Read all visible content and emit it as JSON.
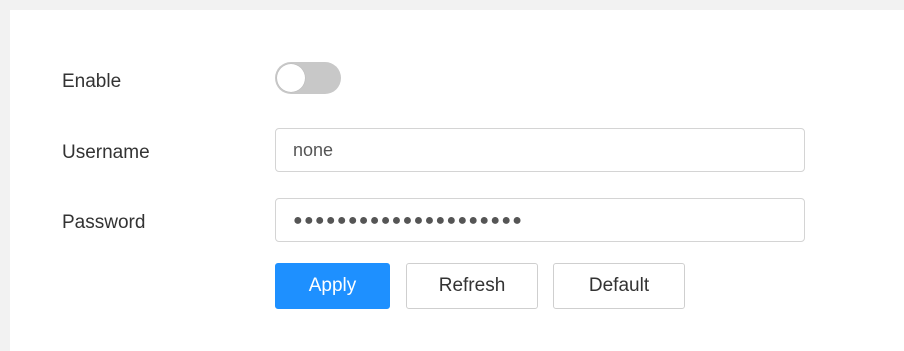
{
  "form": {
    "enable": {
      "label": "Enable",
      "checked": false
    },
    "username": {
      "label": "Username",
      "value": "none"
    },
    "password": {
      "label": "Password",
      "masked_value": "●●●●●●●●●●●●●●●●●●●●●"
    }
  },
  "actions": {
    "apply_label": "Apply",
    "refresh_label": "Refresh",
    "default_label": "Default"
  },
  "colors": {
    "primary": "#1e90ff",
    "toggle_off": "#c8c8c8"
  }
}
